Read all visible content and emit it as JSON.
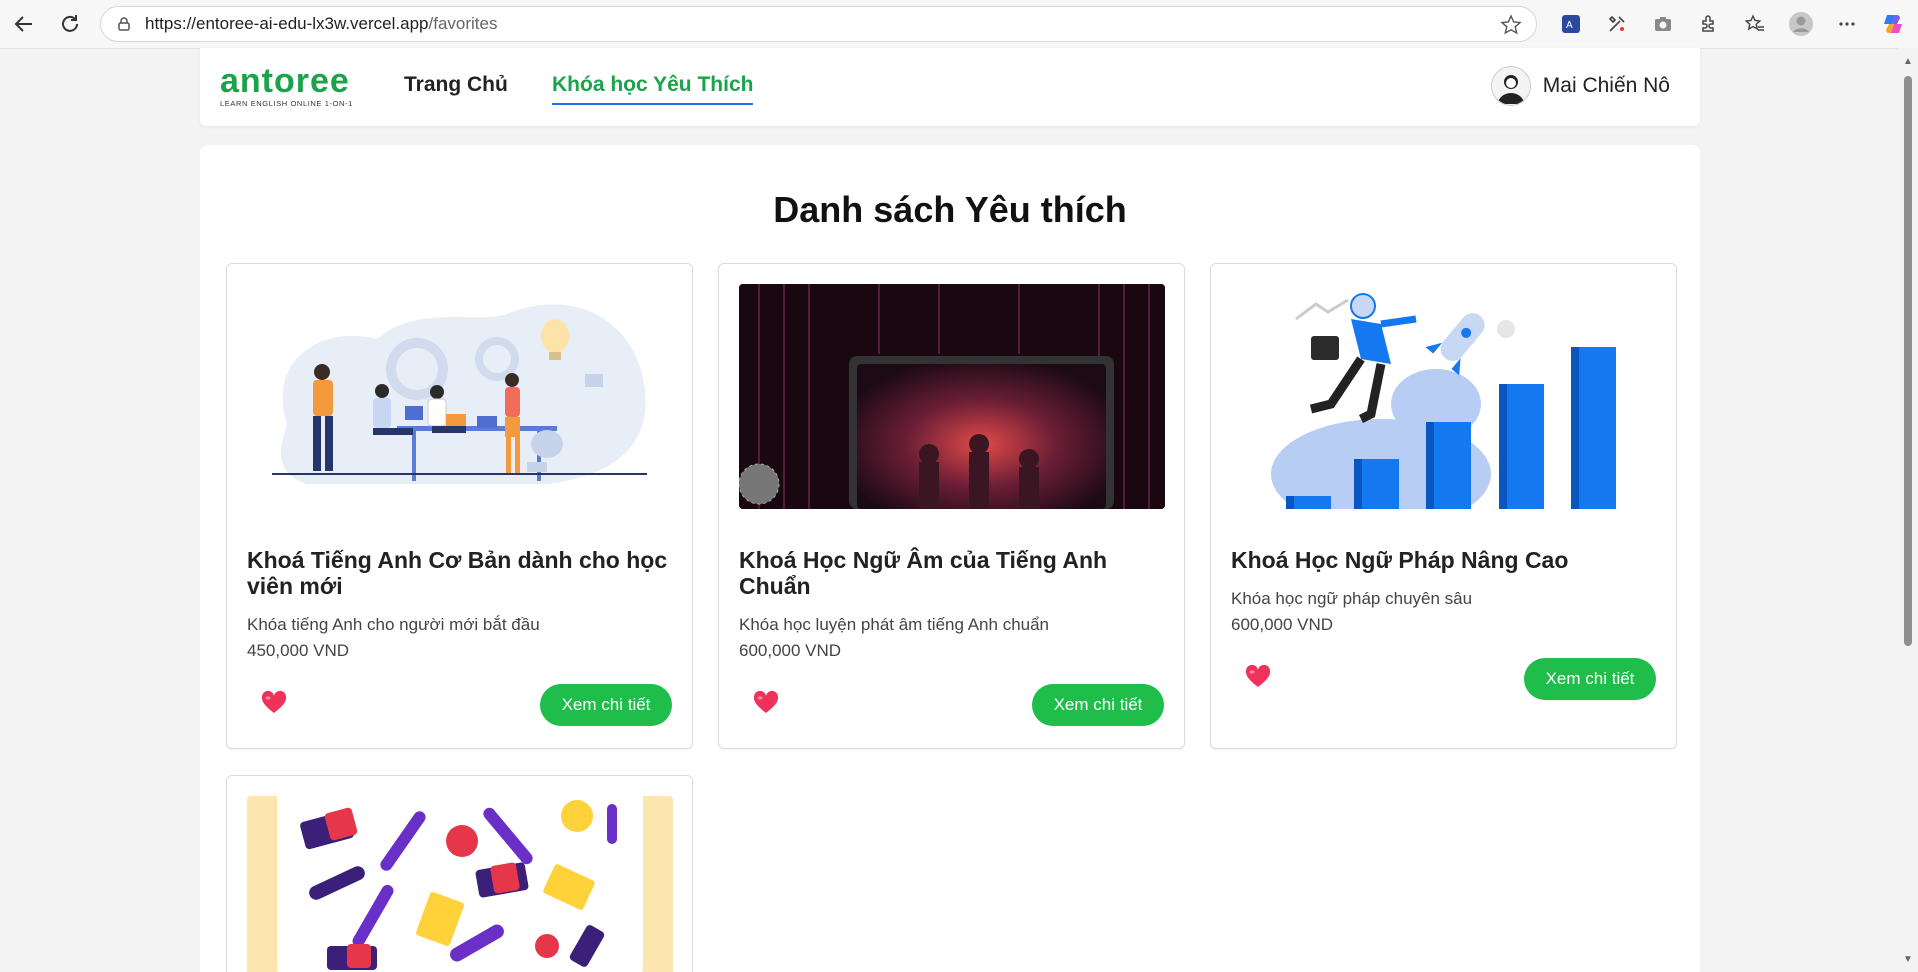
{
  "browser": {
    "url_host": "https://entoree-ai-edu-lx3w.vercel.app",
    "url_path": "/favorites"
  },
  "header": {
    "logo_text": "antoree",
    "logo_tagline": "LEARN ENGLISH ONLINE 1-ON-1",
    "nav": [
      {
        "label": "Trang Chủ",
        "active": false
      },
      {
        "label": "Khóa học Yêu Thích",
        "active": true
      }
    ],
    "user_name": "Mai Chiến Nô"
  },
  "page": {
    "title": "Danh sách Yêu thích"
  },
  "courses": [
    {
      "title": "Khoá Tiếng Anh Cơ Bản dành cho học viên mới",
      "description": "Khóa tiếng Anh cho người mới bắt đầu",
      "price": "450,000 VND",
      "button": "Xem chi tiết",
      "favorited": true,
      "image": "team-office-illustration"
    },
    {
      "title": "Khoá Học Ngữ Âm của Tiếng Anh Chuẩn",
      "description": "Khóa học luyện phát âm tiếng Anh chuẩn",
      "price": "600,000 VND",
      "button": "Xem chi tiết",
      "favorited": true,
      "image": "laptop-concert-photo"
    },
    {
      "title": "Khoá Học Ngữ Pháp Nâng Cao",
      "description": "Khóa học ngữ pháp chuyên sâu",
      "price": "600,000 VND",
      "button": "Xem chi tiết",
      "favorited": true,
      "image": "rocket-growth-illustration"
    },
    {
      "title": "",
      "description": "",
      "price": "",
      "button": "",
      "favorited": true,
      "image": "school-supplies-pattern"
    }
  ],
  "colors": {
    "brand_green": "#1aa34a",
    "button_green": "#1fbd4a",
    "heart_pink": "#f0325a",
    "active_underline": "#1a73e8"
  }
}
